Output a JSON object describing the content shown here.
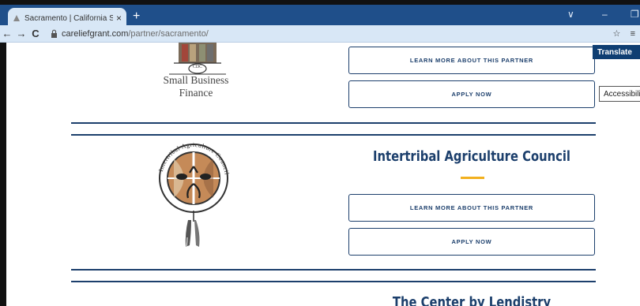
{
  "browser": {
    "tab_title": "Sacramento | California Small Bu",
    "tab_close": "×",
    "new_tab": "+",
    "url_domain": "careliefgrant.com",
    "url_path": "/partner/sacramento/",
    "window_minimize": "–",
    "window_chevron": "∨",
    "window_restore": "❐",
    "back": "←",
    "forward": "→",
    "reload": "C",
    "bookmark": "☆",
    "reading_list": "≡"
  },
  "partners": [
    {
      "logo_text": "Small Business Finance",
      "logo_badge": "CDC",
      "learn_more_label": "LEARN MORE ABOUT THIS PARTNER",
      "apply_label": "APPLY NOW"
    },
    {
      "name": "Intertribal Agriculture Council",
      "logo_ring_text": "Intertribal Agriculture Council",
      "learn_more_label": "LEARN MORE ABOUT THIS PARTNER",
      "apply_label": "APPLY NOW"
    },
    {
      "name": "The Center by Lendistry"
    }
  ],
  "overlays": {
    "translate_label": "Translate",
    "accessibility_label": "Accessibili"
  },
  "colors": {
    "chrome_blue": "#1f4f8a",
    "navy": "#1c3f6c",
    "accent_gold": "#f2b01e"
  }
}
